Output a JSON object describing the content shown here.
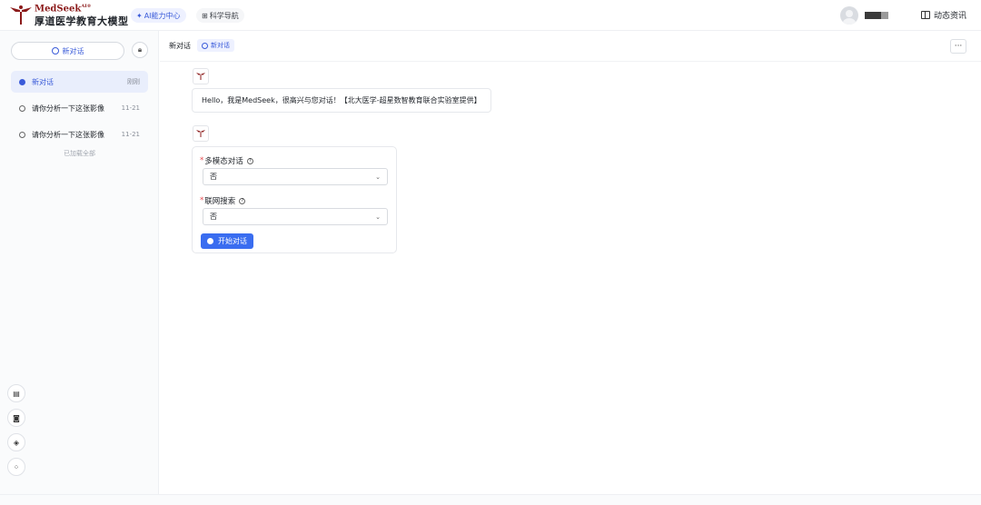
{
  "header": {
    "brand": "MedSeek",
    "brand_sup": "AI®",
    "subtitle": "厚道医学教育大模型",
    "nav": [
      {
        "label": "AI能力中心",
        "icon": "sparkle-icon"
      },
      {
        "label": "科学导航",
        "icon": "grid-icon"
      }
    ],
    "news_label": "动态资讯"
  },
  "sidebar": {
    "new_chat_label": "新对话",
    "conversations": [
      {
        "title": "新对话",
        "time": "刚刚",
        "active": true
      },
      {
        "title": "请你分析一下这张影像",
        "time": "11-21",
        "active": false
      },
      {
        "title": "请你分析一下这张影像",
        "time": "11-21",
        "active": false
      }
    ],
    "loaded_all": "已加载全部",
    "tools": [
      "document-icon",
      "user-card-icon",
      "graduation-cap-icon",
      "apps-icon"
    ]
  },
  "main": {
    "crumb": "新对话",
    "crumb_tag": "新对话",
    "greeting": "Hello，我是MedSeek，很高兴与您对话！【北大医学-超星数智教育联合实验室提供】",
    "form": {
      "field1_label": "多模态对话",
      "field1_value": "否",
      "field2_label": "联网搜索",
      "field2_value": "否",
      "start_label": "开始对话"
    }
  },
  "colors": {
    "accent": "#3a5bd9",
    "primary_button": "#3a6df0",
    "brand_red": "#8b1a1a"
  }
}
